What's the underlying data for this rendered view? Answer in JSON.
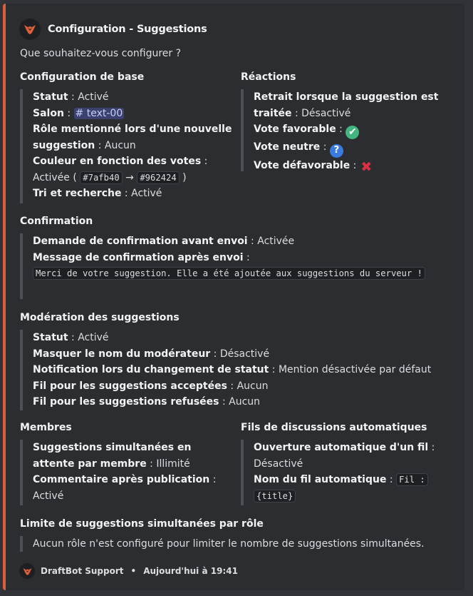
{
  "embed": {
    "accent_color": "#d9603b",
    "author": {
      "name": "Configuration - Suggestions",
      "icon": "draftbot-logo-icon"
    },
    "description": "Que souhaitez-vous configurer ?",
    "base": {
      "title": "Configuration de base",
      "statut_label": "Statut",
      "statut_value": "Activé",
      "salon_label": "Salon",
      "salon_value": "# text-00",
      "role_label": "Rôle mentionné lors d'une nouvelle suggestion",
      "role_value": "Aucun",
      "couleur_label": "Couleur en fonction des votes",
      "couleur_value": "Activée",
      "color_from": "#7afb40",
      "arrow": "→",
      "color_to": "#962424",
      "tri_label": "Tri et recherche",
      "tri_value": "Activé"
    },
    "reactions": {
      "title": "Réactions",
      "retrait_label": "Retrait lorsque la suggestion est traitée",
      "retrait_value": "Désactivé",
      "favorable_label": "Vote favorable",
      "favorable_icon": "✔",
      "neutre_label": "Vote neutre",
      "neutre_icon": "?",
      "defavorable_label": "Vote défavorable",
      "defavorable_icon": "✖"
    },
    "confirmation": {
      "title": "Confirmation",
      "demande_label": "Demande de confirmation avant envoi",
      "demande_value": "Activée",
      "message_label": "Message de confirmation après envoi",
      "message_value": "Merci de votre suggestion. Elle a été ajoutée aux suggestions du serveur !"
    },
    "moderation": {
      "title": "Modération des suggestions",
      "statut_label": "Statut",
      "statut_value": "Activé",
      "masquer_label": "Masquer le nom du modérateur",
      "masquer_value": "Désactivé",
      "notif_label": "Notification lors du changement de statut",
      "notif_value": "Mention désactivée par défaut",
      "fil_acc_label": "Fil pour les suggestions acceptées",
      "fil_acc_value": "Aucun",
      "fil_ref_label": "Fil pour les suggestions refusées",
      "fil_ref_value": "Aucun"
    },
    "membres": {
      "title": "Membres",
      "simult_label": "Suggestions simultanées en attente par membre",
      "simult_value": "Illimité",
      "comment_label": "Commentaire après publication",
      "comment_value": "Activé"
    },
    "fils": {
      "title": "Fils de discussions automatiques",
      "ouverture_label": "Ouverture automatique d'un fil",
      "ouverture_value": "Désactivé",
      "nom_label": "Nom du fil automatique",
      "nom_value": "Fil : {title}"
    },
    "limite": {
      "title": "Limite de suggestions simultanées par rôle",
      "text": "Aucun rôle n'est configuré pour limiter le nombre de suggestions simultanées."
    },
    "footer": {
      "name": "DraftBot Support",
      "separator": "•",
      "timestamp": "Aujourd'hui à 19:41"
    }
  }
}
